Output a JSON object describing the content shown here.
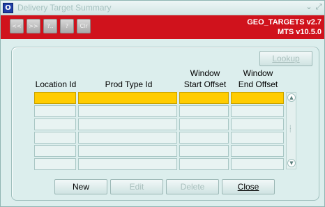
{
  "window": {
    "title": "Delivery Target Summary",
    "minimize_label": "⌄",
    "maximize_label": "⤢",
    "app_icon_label": "O"
  },
  "toolbar": {
    "buttons": [
      {
        "label": "<<",
        "name": "first-record-button"
      },
      {
        "label": ">>",
        "name": "last-record-button"
      },
      {
        "label": "?..",
        "name": "search-button"
      },
      {
        "label": "?",
        "name": "help-button"
      },
      {
        "label": "Clr",
        "name": "clear-button"
      }
    ],
    "info_line1": "GEO_TARGETS v2.7",
    "info_line2": "MTS v10.5.0"
  },
  "panel": {
    "lookup_label": "Lookup",
    "columns": [
      {
        "line1": "",
        "line2": "Location Id"
      },
      {
        "line1": "",
        "line2": "Prod Type Id"
      },
      {
        "line1": "Window",
        "line2": "Start Offset"
      },
      {
        "line1": "Window",
        "line2": "End Offset"
      }
    ],
    "rows": [
      [
        "",
        "",
        "",
        ""
      ],
      [
        "",
        "",
        "",
        ""
      ],
      [
        "",
        "",
        "",
        ""
      ],
      [
        "",
        "",
        "",
        ""
      ],
      [
        "",
        "",
        "",
        ""
      ],
      [
        "",
        "",
        "",
        ""
      ]
    ],
    "selected_row": 0
  },
  "buttons": {
    "new_label": "New",
    "edit_label": "Edit",
    "delete_label": "Delete",
    "close_label": "Close"
  },
  "colors": {
    "toolbar_red": "#d0121c",
    "window_bg": "#dceeed",
    "selected_cell": "#ffcc00"
  }
}
